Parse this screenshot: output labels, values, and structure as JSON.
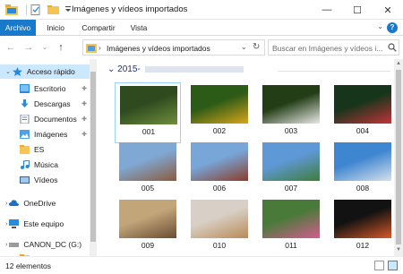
{
  "window": {
    "title": "Imágenes y vídeos importados"
  },
  "title_buttons": {
    "minimize": "—",
    "maximize": "☐",
    "close": "✕"
  },
  "ribbon": {
    "tabs": [
      "Archivo",
      "Inicio",
      "Compartir",
      "Vista"
    ],
    "help_label": "?",
    "expand_label": "⌄"
  },
  "address": {
    "back_glyph": "←",
    "forward_glyph": "→",
    "recent_glyph": "⌄",
    "up_glyph": "↑",
    "separator": "›",
    "path": "Imágenes y vídeos importados",
    "dropdown_glyph": "⌄",
    "refresh_glyph": "↻"
  },
  "search": {
    "placeholder": "Buscar en Imágenes y vídeos i..."
  },
  "nav": {
    "items": [
      {
        "label": "Acceso rápido",
        "icon": "star-icon"
      },
      {
        "label": "Escritorio",
        "icon": "desktop-folder-icon"
      },
      {
        "label": "Descargas",
        "icon": "download-folder-icon"
      },
      {
        "label": "Documentos",
        "icon": "documents-folder-icon"
      },
      {
        "label": "Imágenes",
        "icon": "pictures-folder-icon"
      },
      {
        "label": "ES",
        "icon": "folder-icon"
      },
      {
        "label": "Música",
        "icon": "music-folder-icon"
      },
      {
        "label": "Vídeos",
        "icon": "videos-folder-icon"
      },
      {
        "label": "OneDrive",
        "icon": "cloud-icon"
      },
      {
        "label": "Este equipo",
        "icon": "computer-icon"
      },
      {
        "label": "CANON_DC (G:)",
        "icon": "drive-icon"
      },
      {
        "label": "EN",
        "icon": "folder-icon"
      }
    ],
    "pin_glyph": "📌"
  },
  "content": {
    "group_header": "2015-",
    "group_chevron": "⌄",
    "tiles": [
      "001",
      "002",
      "003",
      "004",
      "005",
      "006",
      "007",
      "008",
      "009",
      "010",
      "011",
      "012"
    ],
    "colors": {
      "001": [
        "#2f4a1e",
        "#6f8f3d"
      ],
      "002": [
        "#2c5a17",
        "#d8a51b"
      ],
      "003": [
        "#233d16",
        "#e9e9e6"
      ],
      "004": [
        "#16351a",
        "#c0343a"
      ],
      "005": [
        "#7fa8d4",
        "#8b5b3c"
      ],
      "006": [
        "#78a6d8",
        "#8a3d2a"
      ],
      "007": [
        "#5f98d6",
        "#3e7d3a"
      ],
      "008": [
        "#3f86d1",
        "#d6e1ea"
      ],
      "009": [
        "#c2a67a",
        "#6a4c31"
      ],
      "010": [
        "#d8d0c6",
        "#b98a57"
      ],
      "011": [
        "#4a7a3a",
        "#d35d8f"
      ],
      "012": [
        "#121212",
        "#d7582a"
      ]
    }
  },
  "status": {
    "count": "12 elementos"
  },
  "colors": {
    "accent": "#1979ca",
    "selection": "#cce8ff",
    "group_text": "#1e3287"
  }
}
